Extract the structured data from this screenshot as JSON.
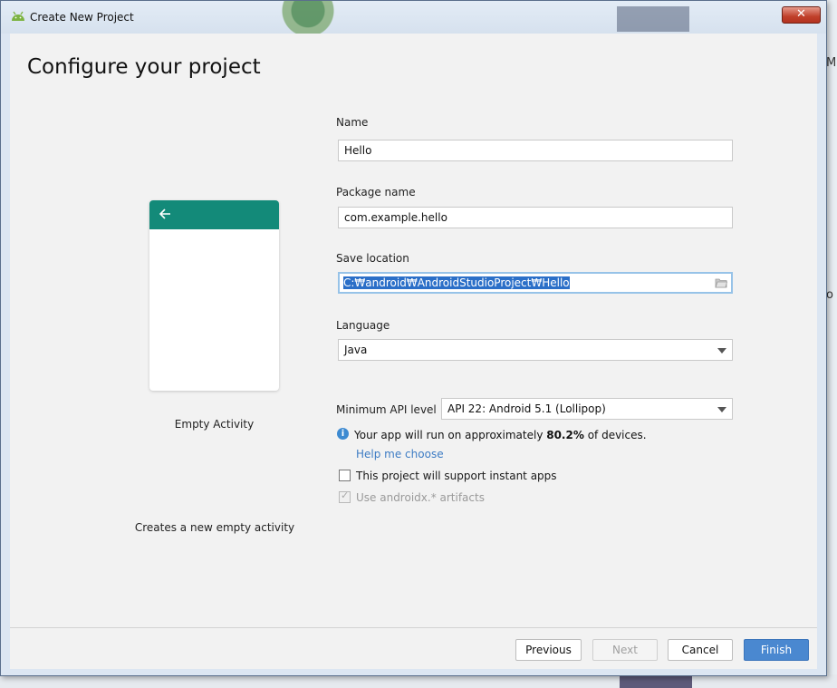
{
  "window": {
    "title": "Create New Project",
    "close_symbol": "✕"
  },
  "page_title": "Configure your project",
  "template": {
    "name": "Empty Activity",
    "description": "Creates a new empty activity"
  },
  "form": {
    "name_label": "Name",
    "name_value": "Hello",
    "package_label": "Package name",
    "package_value": "com.example.hello",
    "save_label": "Save location",
    "save_value": "C:₩android₩AndroidStudioProject₩Hello",
    "language_label": "Language",
    "language_value": "Java",
    "min_api_label": "Minimum API level",
    "min_api_value": "API 22: Android 5.1 (Lollipop)",
    "info_prefix": "Your app will run on approximately ",
    "info_percent": "80.2%",
    "info_suffix": " of devices.",
    "help_link": "Help me choose",
    "instant_apps_label": "This project will support instant apps",
    "instant_apps_checked": false,
    "androidx_label": "Use androidx.* artifacts",
    "androidx_checked": true,
    "androidx_enabled": false
  },
  "buttons": {
    "previous": "Previous",
    "next": "Next",
    "cancel": "Cancel",
    "finish": "Finish"
  },
  "colors": {
    "accent": "#4a88d0",
    "phone_toolbar": "#138a79",
    "link": "#3d7cc4",
    "close": "#c0402b"
  }
}
